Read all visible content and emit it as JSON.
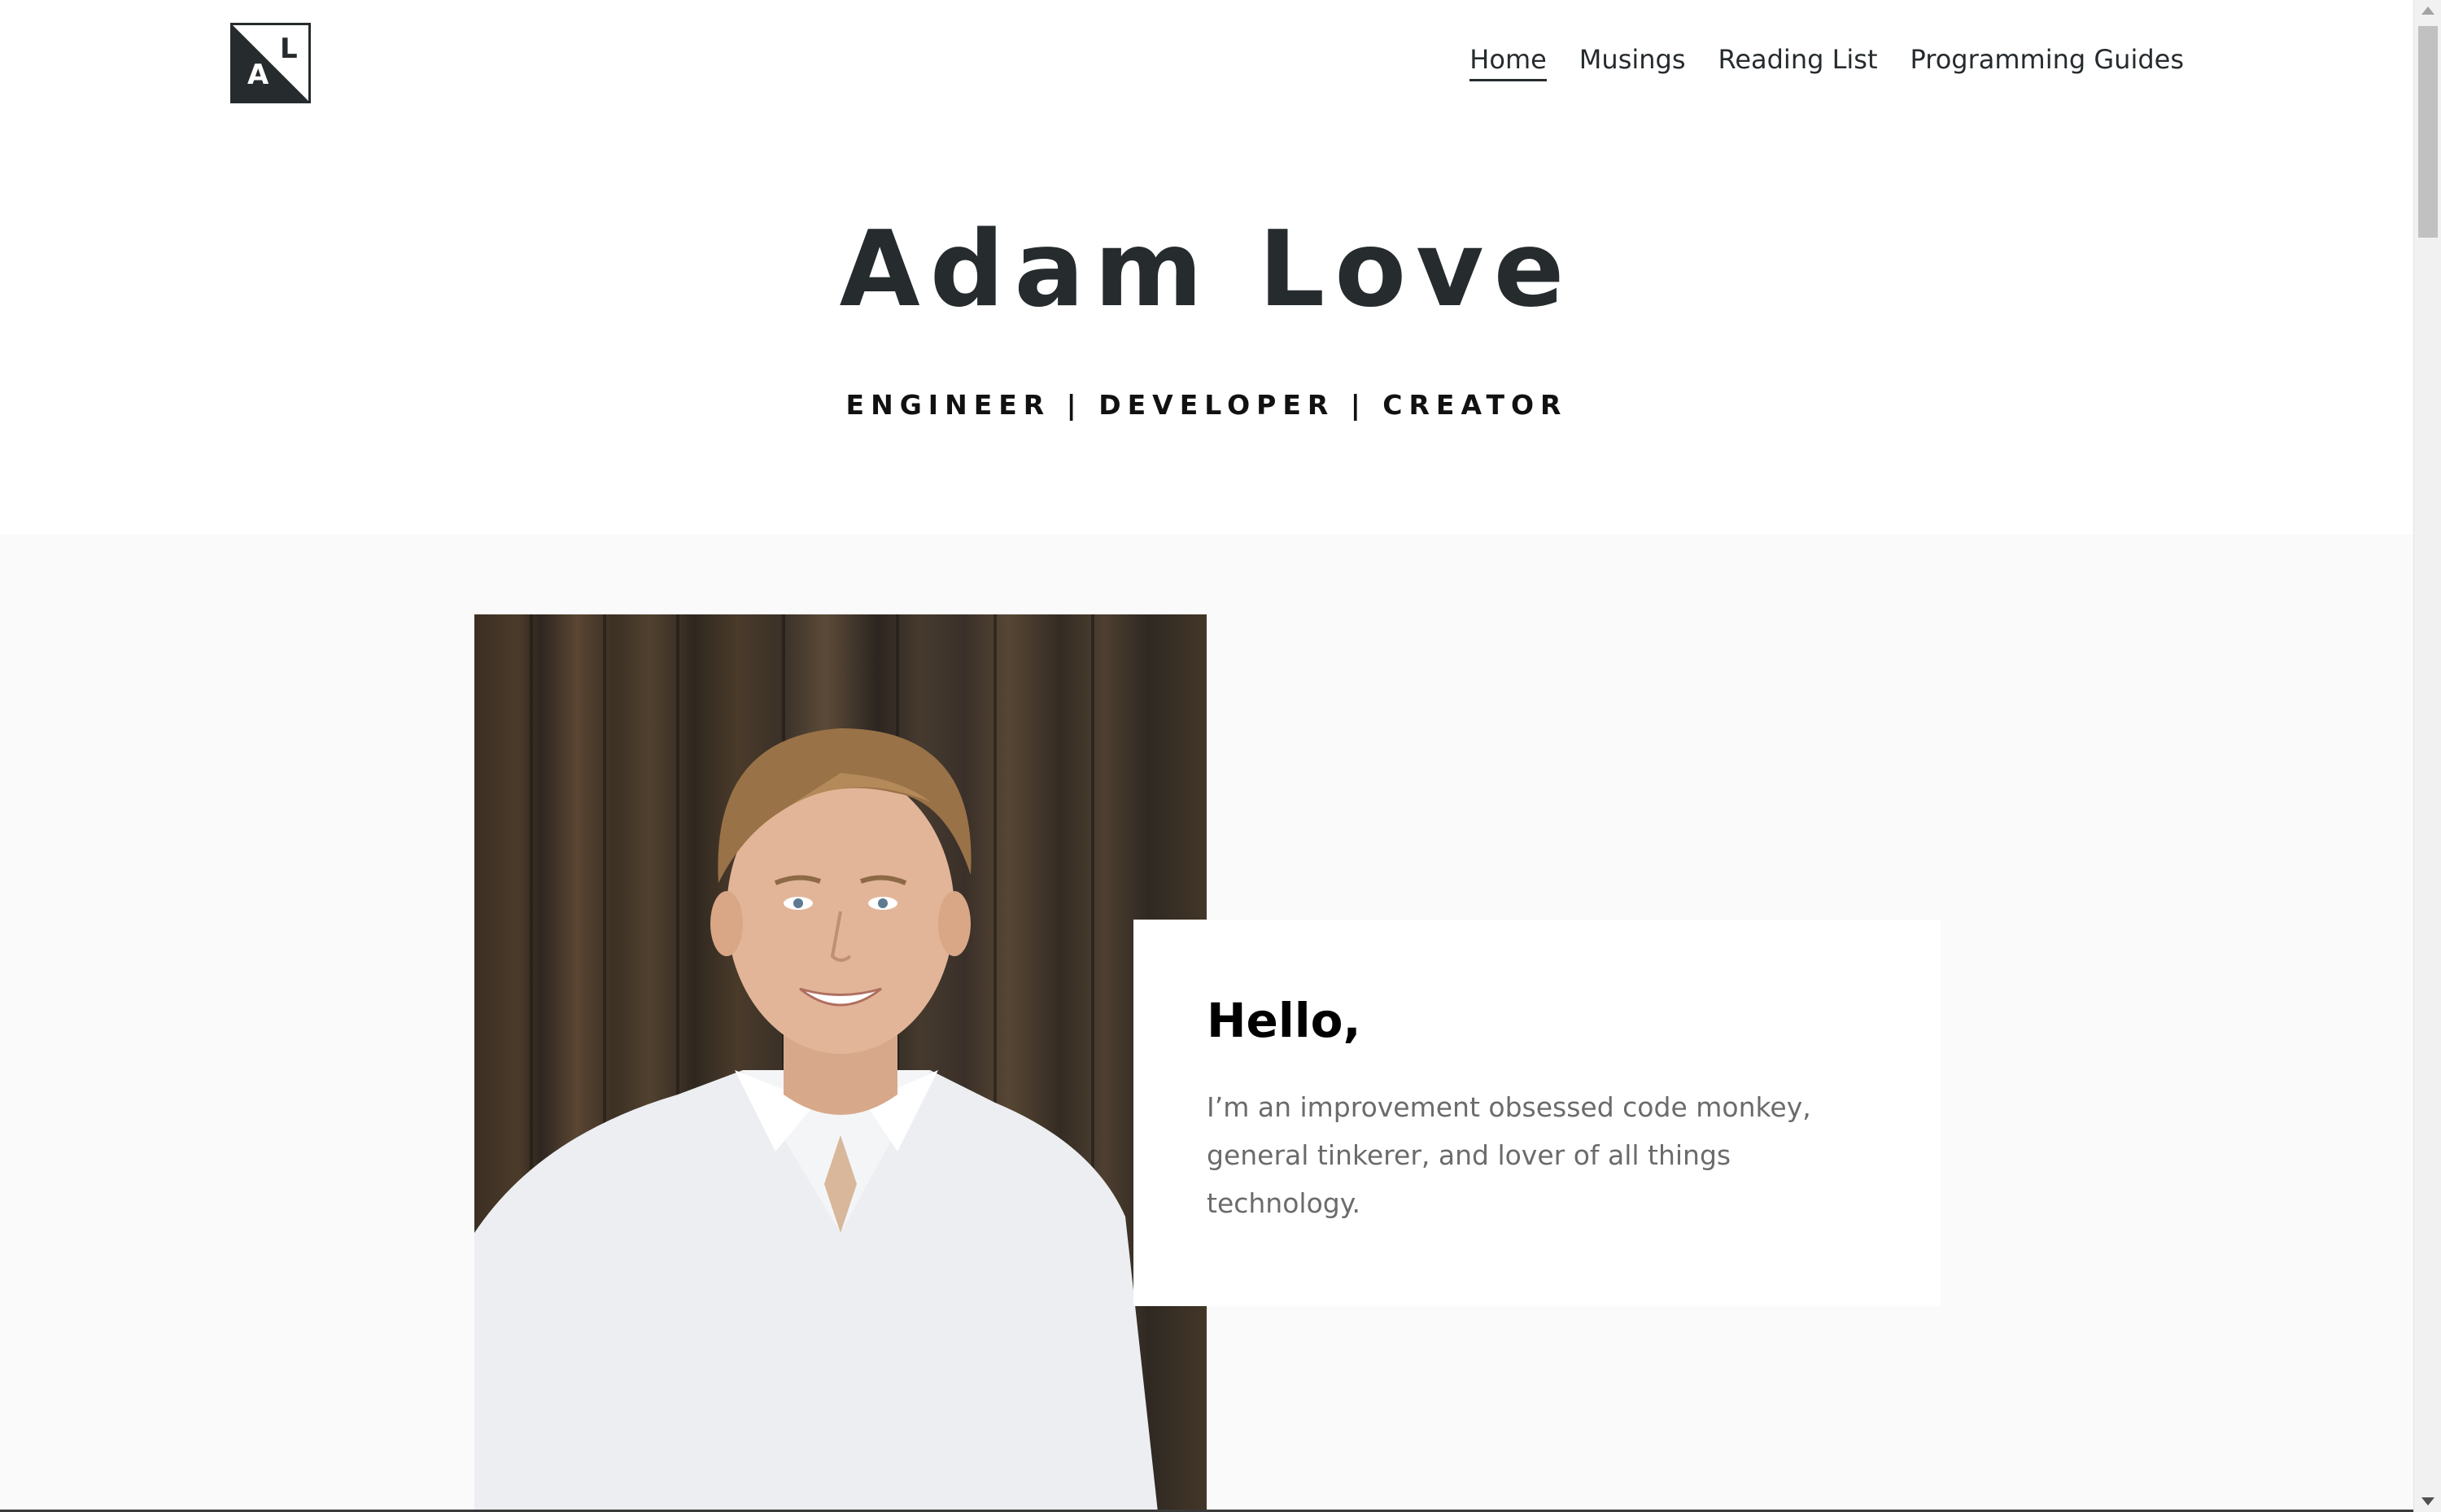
{
  "header": {
    "logo": {
      "letter_a": "A",
      "letter_l": "L"
    },
    "nav": [
      {
        "label": "Home",
        "active": true
      },
      {
        "label": "Musings",
        "active": false
      },
      {
        "label": "Reading List",
        "active": false
      },
      {
        "label": "Programming Guides",
        "active": false
      }
    ]
  },
  "hero": {
    "title": "Adam Love",
    "subtitle": "ENGINEER | DEVELOPER | CREATOR"
  },
  "about": {
    "heading": "Hello,",
    "body": "I’m an improvement obsessed code monkey, general tinkerer, and lover of all things technology."
  },
  "colors": {
    "text_dark": "#262b2e",
    "section_bg": "#fafafa",
    "body_gray": "#6b6b6b",
    "card_bg": "#ffffff"
  },
  "icons": {
    "logo": "al-monogram-logo",
    "scroll_up": "triangle-up-icon",
    "scroll_down": "triangle-down-icon"
  }
}
